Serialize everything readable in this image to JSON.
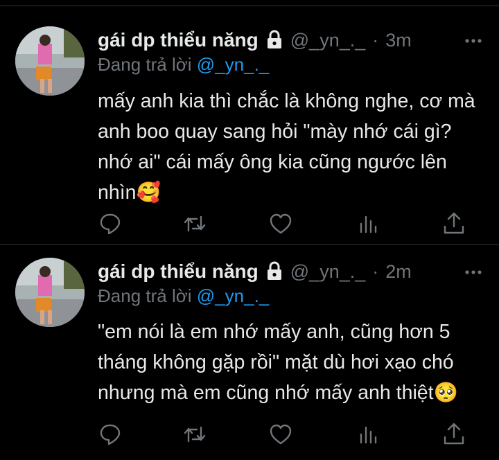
{
  "tweets": [
    {
      "display_name": "gái dp thiểu năng",
      "handle": "@_yn_._",
      "separator": "·",
      "time": "3m",
      "reply_prefix": "Đang trả lời",
      "reply_handle": "@_yn_._",
      "text": "mấy anh kia thì chắc là không nghe, cơ mà anh boo quay sang hỏi \"mày nhớ cái gì? nhớ ai\" cái mấy ông kia cũng ngước lên nhìn🥰"
    },
    {
      "display_name": "gái dp thiểu năng",
      "handle": "@_yn_._",
      "separator": "·",
      "time": "2m",
      "reply_prefix": "Đang trả lời",
      "reply_handle": "@_yn_._",
      "text": "\"em nói là em nhớ mấy anh, cũng hơn 5 tháng không gặp rồi\" mặt dù hơi xạo chó nhưng mà em cũng nhớ mấy anh thiệt🥺"
    }
  ],
  "icons": {
    "lock": "lock-icon",
    "more": "more-icon",
    "reply": "reply-icon",
    "retweet": "retweet-icon",
    "like": "like-icon",
    "views": "views-icon",
    "share": "share-icon"
  },
  "colors": {
    "background": "#000000",
    "text": "#e7e9ea",
    "secondary": "#71767b",
    "link": "#1d9bf0",
    "divider": "#2f3336"
  }
}
